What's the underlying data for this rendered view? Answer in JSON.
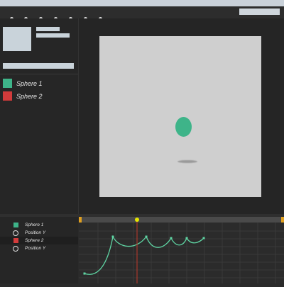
{
  "toolbar": {
    "buttons": [
      "menu-button-1",
      "menu-button-2",
      "menu-button-3",
      "menu-button-4",
      "menu-button-5",
      "menu-button-6",
      "menu-button-7"
    ]
  },
  "scene": {
    "objects": [
      {
        "label": "Sphere 1",
        "color": "#3eb489"
      },
      {
        "label": "Sphere 2",
        "color": "#d23b3b"
      }
    ]
  },
  "viewport": {
    "background": "#cfcfcf",
    "sphere_color": "#3eb489"
  },
  "tracks": [
    {
      "label": "Sphere 1",
      "icon": "square",
      "color": "#3eb489"
    },
    {
      "label": "Position Y",
      "icon": "circle",
      "color": "#e0e0e0"
    },
    {
      "label": "Sphere 2",
      "icon": "square",
      "color": "#d23b3b"
    },
    {
      "label": "Position Y",
      "icon": "circle",
      "color": "#e0e0e0"
    }
  ],
  "timeline": {
    "curve_color": "#5fd6a4",
    "playhead_color": "#c0392b",
    "playhead_knob_color": "#e6e600",
    "range_marker_color": "#e0a020"
  }
}
